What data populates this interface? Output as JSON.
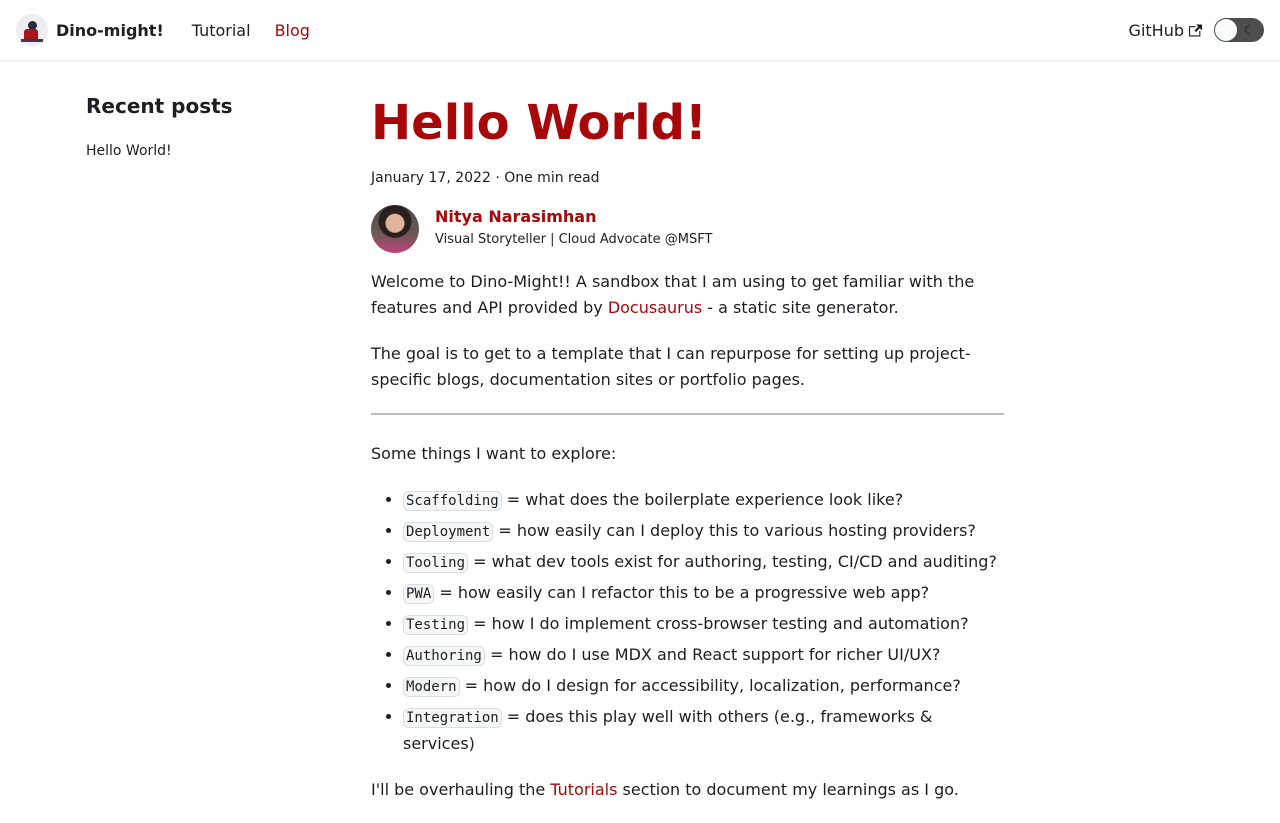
{
  "navbar": {
    "brand_title": "Dino-might!",
    "links": [
      {
        "label": "Tutorial"
      },
      {
        "label": "Blog"
      }
    ],
    "github_label": "GitHub",
    "toggle_icon_glyph": "☾",
    "accent_color": "#a8070a"
  },
  "sidebar": {
    "title": "Recent posts",
    "items": [
      {
        "label": "Hello World!"
      }
    ]
  },
  "post": {
    "title": "Hello World!",
    "meta": "January 17, 2022 · One min read",
    "author": {
      "name": "Nitya Narasimhan",
      "title": "Visual Storyteller | Cloud Advocate @MSFT"
    },
    "intro": {
      "p1_before": "Welcome to Dino-Might!! A sandbox that I am using to get familiar with the features and API provided by ",
      "p1_link": "Docusaurus",
      "p1_after": " - a static site generator.",
      "p2": "The goal is to get to a template that I can repurpose for setting up project-specific blogs, documentation sites or portfolio pages."
    },
    "explore_heading": "Some things I want to explore:",
    "explore_items": [
      {
        "code": "Scaffolding",
        "text": " = what does the boilerplate experience look like?"
      },
      {
        "code": "Deployment",
        "text": " = how easily can I deploy this to various hosting providers?"
      },
      {
        "code": "Tooling",
        "text": " = what dev tools exist for authoring, testing, CI/CD and auditing?"
      },
      {
        "code": "PWA",
        "text": " = how easily can I refactor this to be a progressive web app?"
      },
      {
        "code": "Testing",
        "text": " = how I do implement cross-browser testing and automation?"
      },
      {
        "code": "Authoring",
        "text": " = how do I use MDX and React support for richer UI/UX?"
      },
      {
        "code": "Modern",
        "text": " = how do I design for accessibility, localization, performance?"
      },
      {
        "code": "Integration",
        "text": " = does this play well with others (e.g., frameworks & services)"
      }
    ],
    "closing": {
      "before": "I'll be overhauling the ",
      "link": "Tutorials",
      "after": " section to document my learnings as I go."
    }
  }
}
